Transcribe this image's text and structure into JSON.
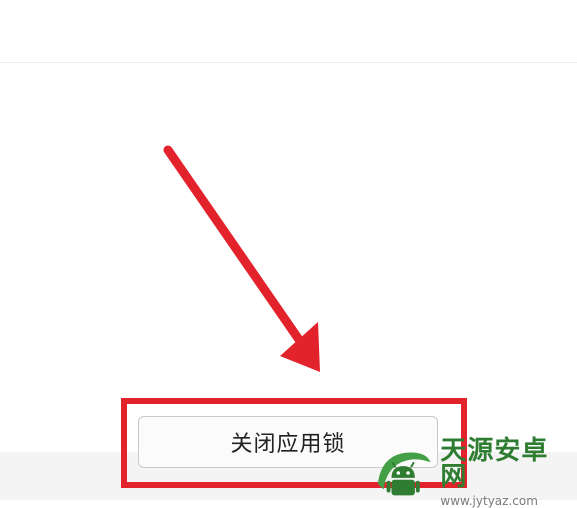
{
  "screen": {
    "button_label": "关闭应用锁"
  },
  "annotation": {
    "color": "#e3232b"
  },
  "watermark": {
    "title": "天源安卓网",
    "url": "www.jytyaz.com",
    "logo_icon": "android-robot-icon",
    "logo_color": "#2e7d32"
  }
}
